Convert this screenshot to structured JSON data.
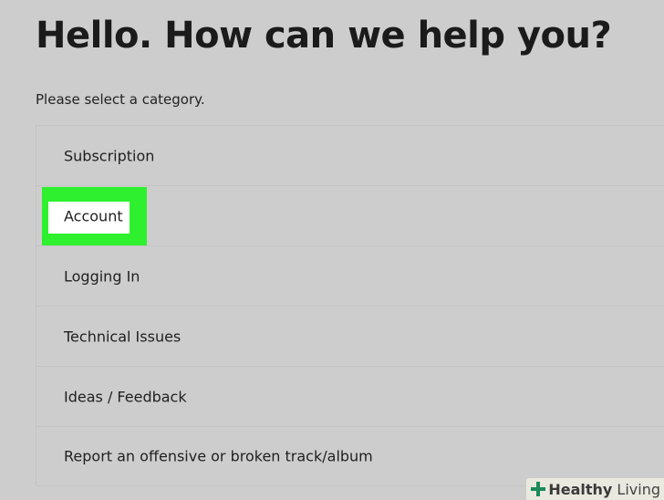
{
  "page": {
    "heading": "Hello. How can we help you?",
    "subtitle": "Please select a category."
  },
  "categories": [
    {
      "label": "Subscription",
      "highlighted": false
    },
    {
      "label": "Account",
      "highlighted": true
    },
    {
      "label": "Logging In",
      "highlighted": false
    },
    {
      "label": "Technical Issues",
      "highlighted": false
    },
    {
      "label": "Ideas / Feedback",
      "highlighted": false
    },
    {
      "label": "Report an offensive or broken track/album",
      "highlighted": false
    }
  ],
  "watermark": {
    "bold": "Healthy",
    "rest": " Living"
  },
  "colors": {
    "background": "#cdcdcd",
    "highlight": "#2ef02e",
    "watermark_green": "#1a8a5a"
  }
}
